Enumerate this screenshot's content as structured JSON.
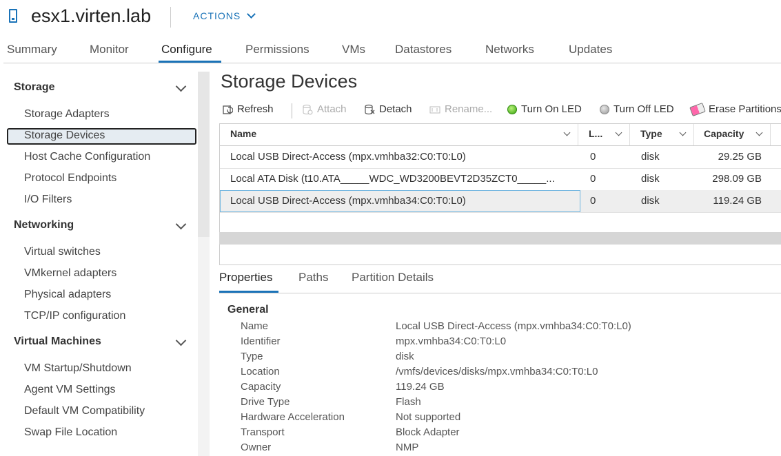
{
  "header": {
    "host": "esx1.virten.lab",
    "actions_label": "ACTIONS"
  },
  "tabs": [
    "Summary",
    "Monitor",
    "Configure",
    "Permissions",
    "VMs",
    "Datastores",
    "Networks",
    "Updates"
  ],
  "sidebar": {
    "sections": [
      {
        "title": "Storage",
        "items": [
          "Storage Adapters",
          "Storage Devices",
          "Host Cache Configuration",
          "Protocol Endpoints",
          "I/O Filters"
        ]
      },
      {
        "title": "Networking",
        "items": [
          "Virtual switches",
          "VMkernel adapters",
          "Physical adapters",
          "TCP/IP configuration"
        ]
      },
      {
        "title": "Virtual Machines",
        "items": [
          "VM Startup/Shutdown",
          "Agent VM Settings",
          "Default VM Compatibility",
          "Swap File Location"
        ]
      }
    ],
    "selected": "Storage Devices"
  },
  "main": {
    "title": "Storage Devices"
  },
  "toolbar": {
    "refresh": "Refresh",
    "attach": "Attach",
    "detach": "Detach",
    "rename": "Rename...",
    "led_on": "Turn On LED",
    "led_off": "Turn Off LED",
    "erase": "Erase Partitions"
  },
  "grid": {
    "columns": [
      "Name",
      "L...",
      "Type",
      "Capacity"
    ],
    "rows": [
      {
        "name": "Local USB Direct-Access (mpx.vmhba32:C0:T0:L0)",
        "lun": "0",
        "type": "disk",
        "capacity": "29.25 GB"
      },
      {
        "name": "Local ATA Disk (t10.ATA_____WDC_WD3200BEVT2D35ZCT0_____...",
        "lun": "0",
        "type": "disk",
        "capacity": "298.09 GB"
      },
      {
        "name": "Local USB Direct-Access (mpx.vmhba34:C0:T0:L0)",
        "lun": "0",
        "type": "disk",
        "capacity": "119.24 GB"
      }
    ]
  },
  "detail_tabs": [
    "Properties",
    "Paths",
    "Partition Details"
  ],
  "properties": {
    "section": "General",
    "rows": [
      {
        "k": "Name",
        "v": "Local USB Direct-Access (mpx.vmhba34:C0:T0:L0)"
      },
      {
        "k": "Identifier",
        "v": "mpx.vmhba34:C0:T0:L0"
      },
      {
        "k": "Type",
        "v": "disk"
      },
      {
        "k": "Location",
        "v": "/vmfs/devices/disks/mpx.vmhba34:C0:T0:L0"
      },
      {
        "k": "Capacity",
        "v": "119.24 GB"
      },
      {
        "k": "Drive Type",
        "v": "Flash"
      },
      {
        "k": "Hardware Acceleration",
        "v": "Not supported"
      },
      {
        "k": "Transport",
        "v": "Block Adapter"
      },
      {
        "k": "Owner",
        "v": "NMP"
      }
    ]
  }
}
